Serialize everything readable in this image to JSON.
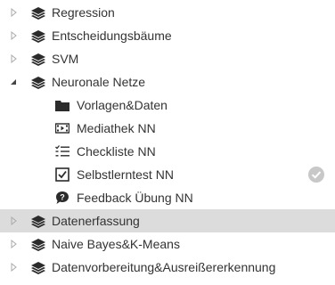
{
  "tree": {
    "items": [
      {
        "label": "Regression",
        "state": "collapsed"
      },
      {
        "label": "Entscheidungsbäume",
        "state": "collapsed"
      },
      {
        "label": "SVM",
        "state": "collapsed"
      },
      {
        "label": "Neuronale Netze",
        "state": "expanded",
        "children": [
          {
            "label": "Vorlagen&Daten",
            "icon": "folder-icon"
          },
          {
            "label": "Mediathek NN",
            "icon": "film-icon"
          },
          {
            "label": "Checkliste NN",
            "icon": "checklist-icon"
          },
          {
            "label": "Selbstlerntest NN",
            "icon": "checkbox-icon",
            "status": "completed"
          },
          {
            "label": "Feedback Übung NN",
            "icon": "feedback-icon"
          }
        ]
      },
      {
        "label": "Datenerfassung",
        "state": "collapsed",
        "selected": true
      },
      {
        "label": "Naive Bayes&K-Means",
        "state": "collapsed"
      },
      {
        "label": "Datenvorbereitung&Ausreißererkennung",
        "state": "collapsed"
      }
    ]
  },
  "colors": {
    "selected_bg": "#dcdcdc",
    "icon": "#2b2b2b",
    "toggle": "#aaaaaa",
    "check": "#c8c8c8"
  }
}
